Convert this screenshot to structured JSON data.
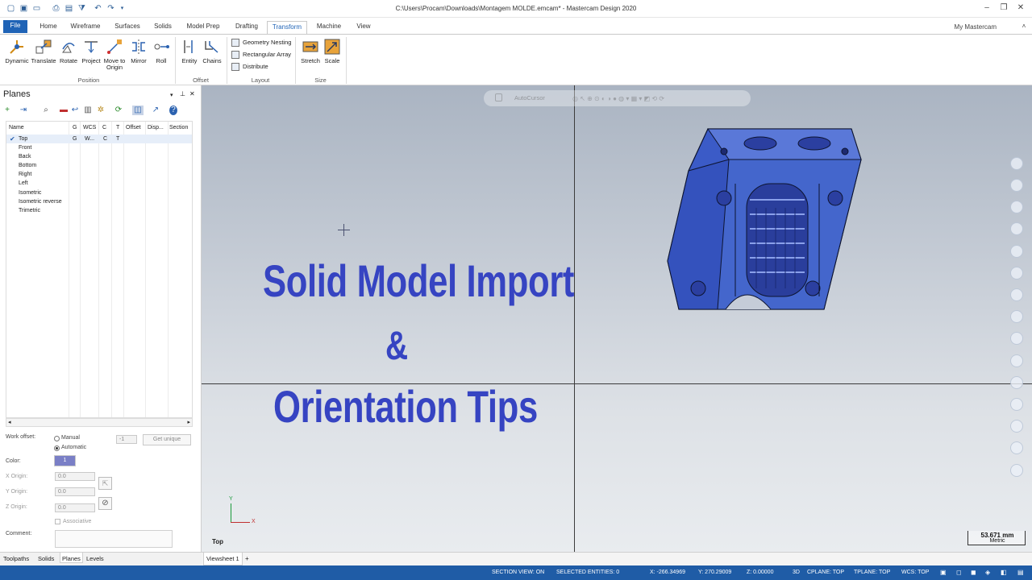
{
  "window": {
    "title": "C:\\Users\\Procam\\Downloads\\Montagem MOLDE.emcam* - Mastercam Design 2020"
  },
  "menu": {
    "tabs": [
      "File",
      "Home",
      "Wireframe",
      "Surfaces",
      "Solids",
      "Model Prep",
      "Drafting",
      "Transform",
      "Machine",
      "View"
    ],
    "active": "Transform",
    "my_mastercam": "My Mastercam"
  },
  "ribbon": {
    "position": {
      "label": "Position",
      "buttons": [
        "Dynamic",
        "Translate",
        "Rotate",
        "Project",
        "Move to Origin",
        "Mirror",
        "Roll"
      ]
    },
    "offset": {
      "label": "Offset",
      "buttons": [
        "Entity",
        "Chains"
      ]
    },
    "layout": {
      "label": "Layout",
      "buttons": [
        "Geometry Nesting",
        "Rectangular Array",
        "Distribute"
      ]
    },
    "size": {
      "label": "Size",
      "buttons": [
        "Stretch",
        "Scale"
      ]
    }
  },
  "planes_panel": {
    "title": "Planes",
    "columns": [
      "Name",
      "G",
      "WCS",
      "C",
      "T",
      "Offset",
      "Disp...",
      "Section"
    ],
    "rows": [
      {
        "name": "Top",
        "g": "G",
        "wcs": "W...",
        "c": "C",
        "t": "T",
        "checked": true
      },
      {
        "name": "Front"
      },
      {
        "name": "Back"
      },
      {
        "name": "Bottom"
      },
      {
        "name": "Right"
      },
      {
        "name": "Left"
      },
      {
        "name": "Isometric"
      },
      {
        "name": "Isometric reverse"
      },
      {
        "name": "Trimetric"
      }
    ],
    "work_offset_label": "Work offset:",
    "manual_label": "Manual",
    "automatic_label": "Automatic",
    "work_offset_value": "-1",
    "get_unique_label": "Get unique",
    "color_label": "Color:",
    "color_value": "1",
    "x_origin_label": "X Origin:",
    "y_origin_label": "Y Origin:",
    "z_origin_label": "Z Origin:",
    "x_origin": "0.0",
    "y_origin": "0.0",
    "z_origin": "0.0",
    "associative_label": "Associative",
    "comment_label": "Comment:"
  },
  "bottom_tabs": [
    "Toolpaths",
    "Solids",
    "Planes",
    "Levels"
  ],
  "viewport": {
    "autocursor_label": "AutoCursor",
    "headline_1": "Solid Model Import",
    "headline_2": "&",
    "headline_3": "Orientation Tips",
    "view_name": "Top",
    "scale_value": "53.671 mm",
    "scale_unit": "Metric",
    "axis_y": "Y",
    "axis_x": "X"
  },
  "viewsheet": {
    "tab": "Viewsheet 1",
    "add": "+"
  },
  "status": {
    "section_view": "SECTION VIEW: ON",
    "selected": "SELECTED ENTITIES: 0",
    "x": "X:   -266.34969",
    "y": "Y:   270.29009",
    "z": "Z:   0.00000",
    "mode": "3D",
    "cplane": "CPLANE: TOP",
    "tplane": "TPLANE: TOP",
    "wcs": "WCS: TOP"
  },
  "colors": {
    "accent": "#1f63b6",
    "status_bar": "#1f5ca6",
    "headline": "#3644c2",
    "model": "#3c5cc8"
  }
}
